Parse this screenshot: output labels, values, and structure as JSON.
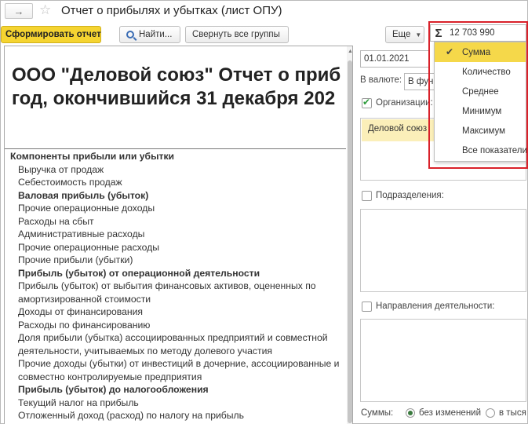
{
  "window": {
    "title": "Отчет о прибылях и убытках  (лист ОПУ)"
  },
  "toolbar": {
    "generate_label": "Сформировать отчет",
    "find_label": "Найти...",
    "collapse_label": "Свернуть все группы",
    "more_label": "Еще"
  },
  "report": {
    "title_line1": "ООО \"Деловой союз\" Отчет о приб",
    "title_line2": "год, окончившийся 31 декабря 202",
    "rows": [
      "Компоненты прибыли или убытки",
      "Выручка от продаж",
      "Себестоимость продаж",
      "Валовая прибыль (убыток)",
      "Прочие операционные доходы",
      "Расходы на сбыт",
      "Административные расходы",
      "Прочие операционные расходы",
      "Прочие прибыли (убытки)",
      "Прибыль (убыток) от операционной деятельности",
      "Прибыль (убыток) от выбытия финансовых активов, оцененных по амортизированной стоимости",
      "Доходы от финансирования",
      "Расходы по финансированию",
      "Доля прибыли (убытка) ассоциированных предприятий и совместной деятельности, учитываемых по методу долевого участия",
      "Прочие доходы (убытки) от инвестиций в дочерние, ассоциированные и совместно контролируемые предприятия",
      "Прибыль (убыток) до налогообложения",
      "Текущий налог на прибыль",
      "Отложенный доход (расход) по налогу на прибыль"
    ]
  },
  "settings": {
    "date": "01.01.2021",
    "currency_label": "В валюте:",
    "currency_value": "В функ",
    "organizations_label": "Организации:",
    "organizations_checked": true,
    "organization_item": "Деловой союз",
    "divisions_label": "Подразделения:",
    "directions_label": "Направления деятельности:",
    "sums_label": "Суммы:",
    "sums_option1": "без изменений",
    "sums_option2": "в тыся"
  },
  "sum": {
    "symbol": "Σ",
    "value": "12 703 990",
    "options": [
      "Сумма",
      "Количество",
      "Среднее",
      "Минимум",
      "Максимум",
      "Все показатели"
    ],
    "selected": "Сумма"
  },
  "colors": {
    "accent": "#f5d431",
    "highlight": "#d9212a",
    "selection": "#fbefb9"
  }
}
